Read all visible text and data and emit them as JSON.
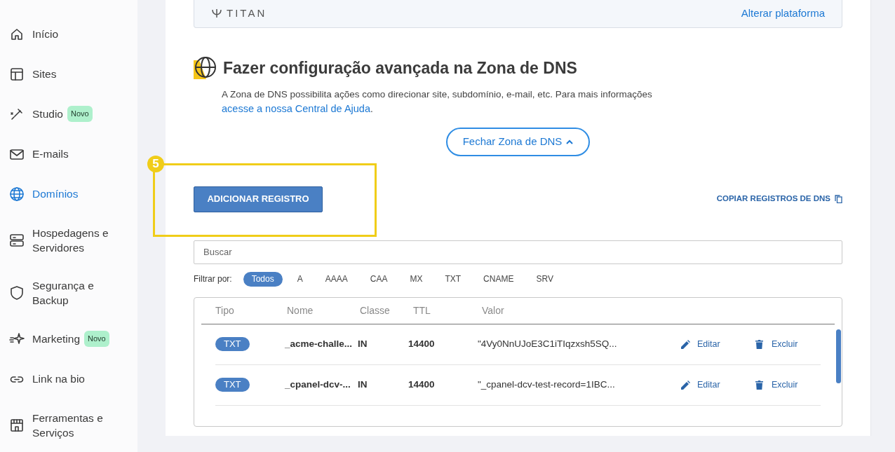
{
  "sidebar": {
    "items": [
      {
        "label": "Início",
        "selected": false
      },
      {
        "label": "Sites",
        "selected": false
      },
      {
        "label": "Studio",
        "selected": false,
        "badge": "Novo"
      },
      {
        "label": "E-mails",
        "selected": false
      },
      {
        "label": "Domínios",
        "selected": true
      },
      {
        "label": "Hospedagens e Servidores",
        "selected": false
      },
      {
        "label": "Segurança e Backup",
        "selected": false
      },
      {
        "label": "Marketing",
        "selected": false,
        "badge": "Novo"
      },
      {
        "label": "Link na bio",
        "selected": false
      },
      {
        "label": "Ferramentas e Serviços",
        "selected": false
      }
    ]
  },
  "platform_card": {
    "logo": "TITAN",
    "link": "Alterar plataforma"
  },
  "dns_section": {
    "title": "Fazer configuração avançada na Zona de DNS",
    "description": "A Zona de DNS possibilita ações como direcionar site, subdomínio, e-mail, etc. Para mais informações",
    "help_link": "acesse a nossa Central de Ajuda",
    "description_end": ".",
    "close_button": "Fechar Zona de DNS",
    "add_button": "ADICIONAR REGISTRO",
    "copy_link": "COPIAR REGISTROS DE DNS",
    "search": {
      "placeholder": "Buscar"
    },
    "filter_label": "Filtrar por:",
    "filters": [
      {
        "label": "Todos",
        "selected": true
      },
      {
        "label": "A",
        "selected": false
      },
      {
        "label": "AAAA",
        "selected": false
      },
      {
        "label": "CAA",
        "selected": false
      },
      {
        "label": "MX",
        "selected": false
      },
      {
        "label": "TXT",
        "selected": false
      },
      {
        "label": "CNAME",
        "selected": false
      },
      {
        "label": "SRV",
        "selected": false
      }
    ],
    "table": {
      "columns": [
        "Tipo",
        "Nome",
        "Classe",
        "TTL",
        "Valor"
      ],
      "rows": [
        {
          "type": "TXT",
          "name": "_acme-challe...",
          "class": "IN",
          "ttl": "14400",
          "value": "\"4Vy0NnUJoE3C1iTIqzxsh5SQ...",
          "edit": "Editar",
          "delete": "Excluir"
        },
        {
          "type": "TXT",
          "name": "_cpanel-dcv-...",
          "class": "IN",
          "ttl": "14400",
          "value": "\"_cpanel-dcv-test-record=1IBC...",
          "edit": "Editar",
          "delete": "Excluir"
        }
      ]
    }
  },
  "annotation": {
    "step": "5"
  }
}
